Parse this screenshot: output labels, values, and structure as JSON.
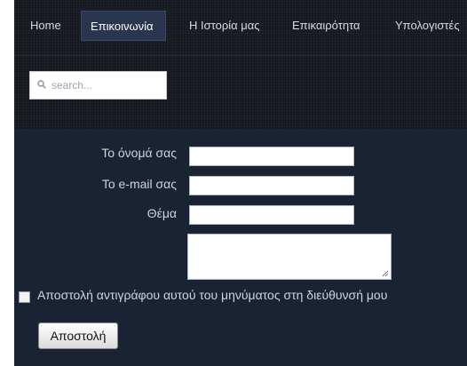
{
  "nav": {
    "items": [
      {
        "label": "Home"
      },
      {
        "label": "Επικοινωνία"
      },
      {
        "label": "Η Ιστορία μας"
      },
      {
        "label": "Επικαιρότητα"
      },
      {
        "label": "Υπολογιστές"
      }
    ],
    "active_index": 1
  },
  "search": {
    "placeholder": "search...",
    "icon": "magnifier-icon"
  },
  "form": {
    "name_label": "Το όνομά σας",
    "email_label": "Το e-mail σας",
    "subject_label": "Θέμα",
    "name_value": "",
    "email_value": "",
    "subject_value": "",
    "message_value": "",
    "copy_checkbox_label": "Αποστολή αντιγράφου αυτού του μηνύματος στη διεύθυνσή μου",
    "copy_checked": false,
    "submit_label": "Αποστολή"
  },
  "colors": {
    "nav_background": "#16181f",
    "active_tab": "#2a3550",
    "form_background": "#1a2333",
    "label_text": "#cfd5df"
  }
}
